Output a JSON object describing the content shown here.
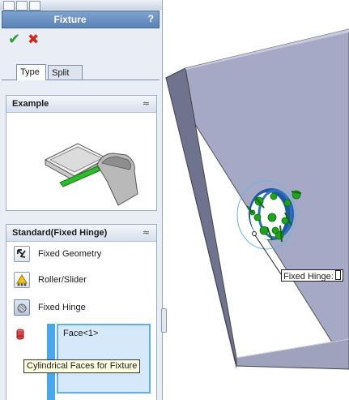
{
  "panel": {
    "title": "Fixture",
    "help_label": "?",
    "ok_icon": "check-icon",
    "cancel_icon": "x-icon",
    "tabs": [
      {
        "label": "Type",
        "active": true
      },
      {
        "label": "Split",
        "active": false
      }
    ],
    "example": {
      "title": "Example",
      "collapse_icon": "double-chevron-up-icon"
    },
    "standard": {
      "title": "Standard(Fixed Hinge)",
      "collapse_icon": "double-chevron-up-icon",
      "options": [
        {
          "label": "Fixed Geometry",
          "icon": "fixed-geometry-icon",
          "selected": false
        },
        {
          "label": "Roller/Slider",
          "icon": "roller-slider-icon",
          "selected": false
        },
        {
          "label": "Fixed Hinge",
          "icon": "fixed-hinge-icon",
          "selected": true
        }
      ],
      "faces_icon": "cylinder-face-icon",
      "selected_faces": [
        "Face<1>"
      ]
    },
    "tooltip": "Cylindrical Faces for Fixture"
  },
  "viewport": {
    "callout_label": "Fixed Hinge:"
  },
  "colors": {
    "title_bar": "#6a8fc3",
    "accent_blue": "#4aa7ec",
    "hinge_green": "#1aa31a",
    "plate_gray": "#a3a7c2"
  }
}
